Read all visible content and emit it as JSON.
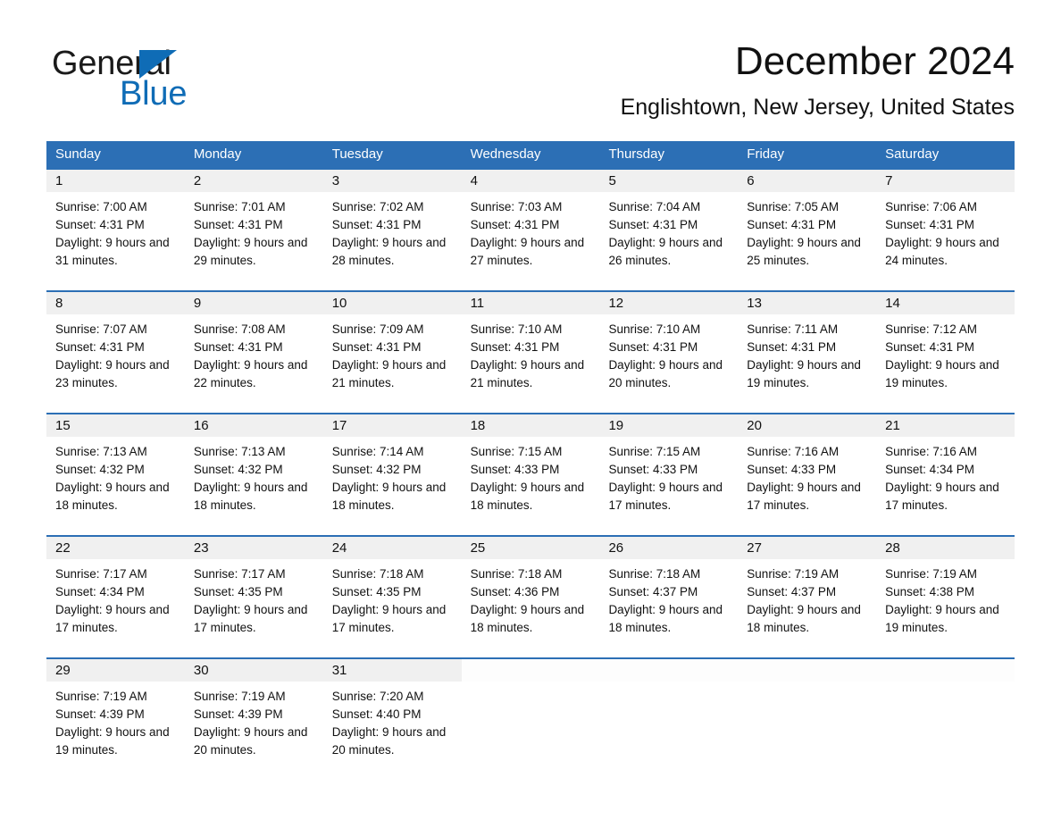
{
  "logo": {
    "word_dark": "General",
    "word_blue": "Blue",
    "triangle": "blue-triangle-icon",
    "colors": {
      "dark": "#1a1a1a",
      "blue": "#0f6cb6"
    }
  },
  "header": {
    "title": "December 2024",
    "subtitle": "Englishtown, New Jersey, United States"
  },
  "theme": {
    "header_blue": "#2c6fb5",
    "daynum_bg": "#f0f0f0",
    "text": "#111111",
    "page_bg": "#ffffff"
  },
  "calendar": {
    "weekday_headers": [
      "Sunday",
      "Monday",
      "Tuesday",
      "Wednesday",
      "Thursday",
      "Friday",
      "Saturday"
    ],
    "weeks": [
      [
        {
          "day": "1",
          "sunrise": "Sunrise: 7:00 AM",
          "sunset": "Sunset: 4:31 PM",
          "daylight": "Daylight: 9 hours and 31 minutes."
        },
        {
          "day": "2",
          "sunrise": "Sunrise: 7:01 AM",
          "sunset": "Sunset: 4:31 PM",
          "daylight": "Daylight: 9 hours and 29 minutes."
        },
        {
          "day": "3",
          "sunrise": "Sunrise: 7:02 AM",
          "sunset": "Sunset: 4:31 PM",
          "daylight": "Daylight: 9 hours and 28 minutes."
        },
        {
          "day": "4",
          "sunrise": "Sunrise: 7:03 AM",
          "sunset": "Sunset: 4:31 PM",
          "daylight": "Daylight: 9 hours and 27 minutes."
        },
        {
          "day": "5",
          "sunrise": "Sunrise: 7:04 AM",
          "sunset": "Sunset: 4:31 PM",
          "daylight": "Daylight: 9 hours and 26 minutes."
        },
        {
          "day": "6",
          "sunrise": "Sunrise: 7:05 AM",
          "sunset": "Sunset: 4:31 PM",
          "daylight": "Daylight: 9 hours and 25 minutes."
        },
        {
          "day": "7",
          "sunrise": "Sunrise: 7:06 AM",
          "sunset": "Sunset: 4:31 PM",
          "daylight": "Daylight: 9 hours and 24 minutes."
        }
      ],
      [
        {
          "day": "8",
          "sunrise": "Sunrise: 7:07 AM",
          "sunset": "Sunset: 4:31 PM",
          "daylight": "Daylight: 9 hours and 23 minutes."
        },
        {
          "day": "9",
          "sunrise": "Sunrise: 7:08 AM",
          "sunset": "Sunset: 4:31 PM",
          "daylight": "Daylight: 9 hours and 22 minutes."
        },
        {
          "day": "10",
          "sunrise": "Sunrise: 7:09 AM",
          "sunset": "Sunset: 4:31 PM",
          "daylight": "Daylight: 9 hours and 21 minutes."
        },
        {
          "day": "11",
          "sunrise": "Sunrise: 7:10 AM",
          "sunset": "Sunset: 4:31 PM",
          "daylight": "Daylight: 9 hours and 21 minutes."
        },
        {
          "day": "12",
          "sunrise": "Sunrise: 7:10 AM",
          "sunset": "Sunset: 4:31 PM",
          "daylight": "Daylight: 9 hours and 20 minutes."
        },
        {
          "day": "13",
          "sunrise": "Sunrise: 7:11 AM",
          "sunset": "Sunset: 4:31 PM",
          "daylight": "Daylight: 9 hours and 19 minutes."
        },
        {
          "day": "14",
          "sunrise": "Sunrise: 7:12 AM",
          "sunset": "Sunset: 4:31 PM",
          "daylight": "Daylight: 9 hours and 19 minutes."
        }
      ],
      [
        {
          "day": "15",
          "sunrise": "Sunrise: 7:13 AM",
          "sunset": "Sunset: 4:32 PM",
          "daylight": "Daylight: 9 hours and 18 minutes."
        },
        {
          "day": "16",
          "sunrise": "Sunrise: 7:13 AM",
          "sunset": "Sunset: 4:32 PM",
          "daylight": "Daylight: 9 hours and 18 minutes."
        },
        {
          "day": "17",
          "sunrise": "Sunrise: 7:14 AM",
          "sunset": "Sunset: 4:32 PM",
          "daylight": "Daylight: 9 hours and 18 minutes."
        },
        {
          "day": "18",
          "sunrise": "Sunrise: 7:15 AM",
          "sunset": "Sunset: 4:33 PM",
          "daylight": "Daylight: 9 hours and 18 minutes."
        },
        {
          "day": "19",
          "sunrise": "Sunrise: 7:15 AM",
          "sunset": "Sunset: 4:33 PM",
          "daylight": "Daylight: 9 hours and 17 minutes."
        },
        {
          "day": "20",
          "sunrise": "Sunrise: 7:16 AM",
          "sunset": "Sunset: 4:33 PM",
          "daylight": "Daylight: 9 hours and 17 minutes."
        },
        {
          "day": "21",
          "sunrise": "Sunrise: 7:16 AM",
          "sunset": "Sunset: 4:34 PM",
          "daylight": "Daylight: 9 hours and 17 minutes."
        }
      ],
      [
        {
          "day": "22",
          "sunrise": "Sunrise: 7:17 AM",
          "sunset": "Sunset: 4:34 PM",
          "daylight": "Daylight: 9 hours and 17 minutes."
        },
        {
          "day": "23",
          "sunrise": "Sunrise: 7:17 AM",
          "sunset": "Sunset: 4:35 PM",
          "daylight": "Daylight: 9 hours and 17 minutes."
        },
        {
          "day": "24",
          "sunrise": "Sunrise: 7:18 AM",
          "sunset": "Sunset: 4:35 PM",
          "daylight": "Daylight: 9 hours and 17 minutes."
        },
        {
          "day": "25",
          "sunrise": "Sunrise: 7:18 AM",
          "sunset": "Sunset: 4:36 PM",
          "daylight": "Daylight: 9 hours and 18 minutes."
        },
        {
          "day": "26",
          "sunrise": "Sunrise: 7:18 AM",
          "sunset": "Sunset: 4:37 PM",
          "daylight": "Daylight: 9 hours and 18 minutes."
        },
        {
          "day": "27",
          "sunrise": "Sunrise: 7:19 AM",
          "sunset": "Sunset: 4:37 PM",
          "daylight": "Daylight: 9 hours and 18 minutes."
        },
        {
          "day": "28",
          "sunrise": "Sunrise: 7:19 AM",
          "sunset": "Sunset: 4:38 PM",
          "daylight": "Daylight: 9 hours and 19 minutes."
        }
      ],
      [
        {
          "day": "29",
          "sunrise": "Sunrise: 7:19 AM",
          "sunset": "Sunset: 4:39 PM",
          "daylight": "Daylight: 9 hours and 19 minutes."
        },
        {
          "day": "30",
          "sunrise": "Sunrise: 7:19 AM",
          "sunset": "Sunset: 4:39 PM",
          "daylight": "Daylight: 9 hours and 20 minutes."
        },
        {
          "day": "31",
          "sunrise": "Sunrise: 7:20 AM",
          "sunset": "Sunset: 4:40 PM",
          "daylight": "Daylight: 9 hours and 20 minutes."
        },
        {
          "day": "",
          "sunrise": "",
          "sunset": "",
          "daylight": ""
        },
        {
          "day": "",
          "sunrise": "",
          "sunset": "",
          "daylight": ""
        },
        {
          "day": "",
          "sunrise": "",
          "sunset": "",
          "daylight": ""
        },
        {
          "day": "",
          "sunrise": "",
          "sunset": "",
          "daylight": ""
        }
      ]
    ]
  }
}
